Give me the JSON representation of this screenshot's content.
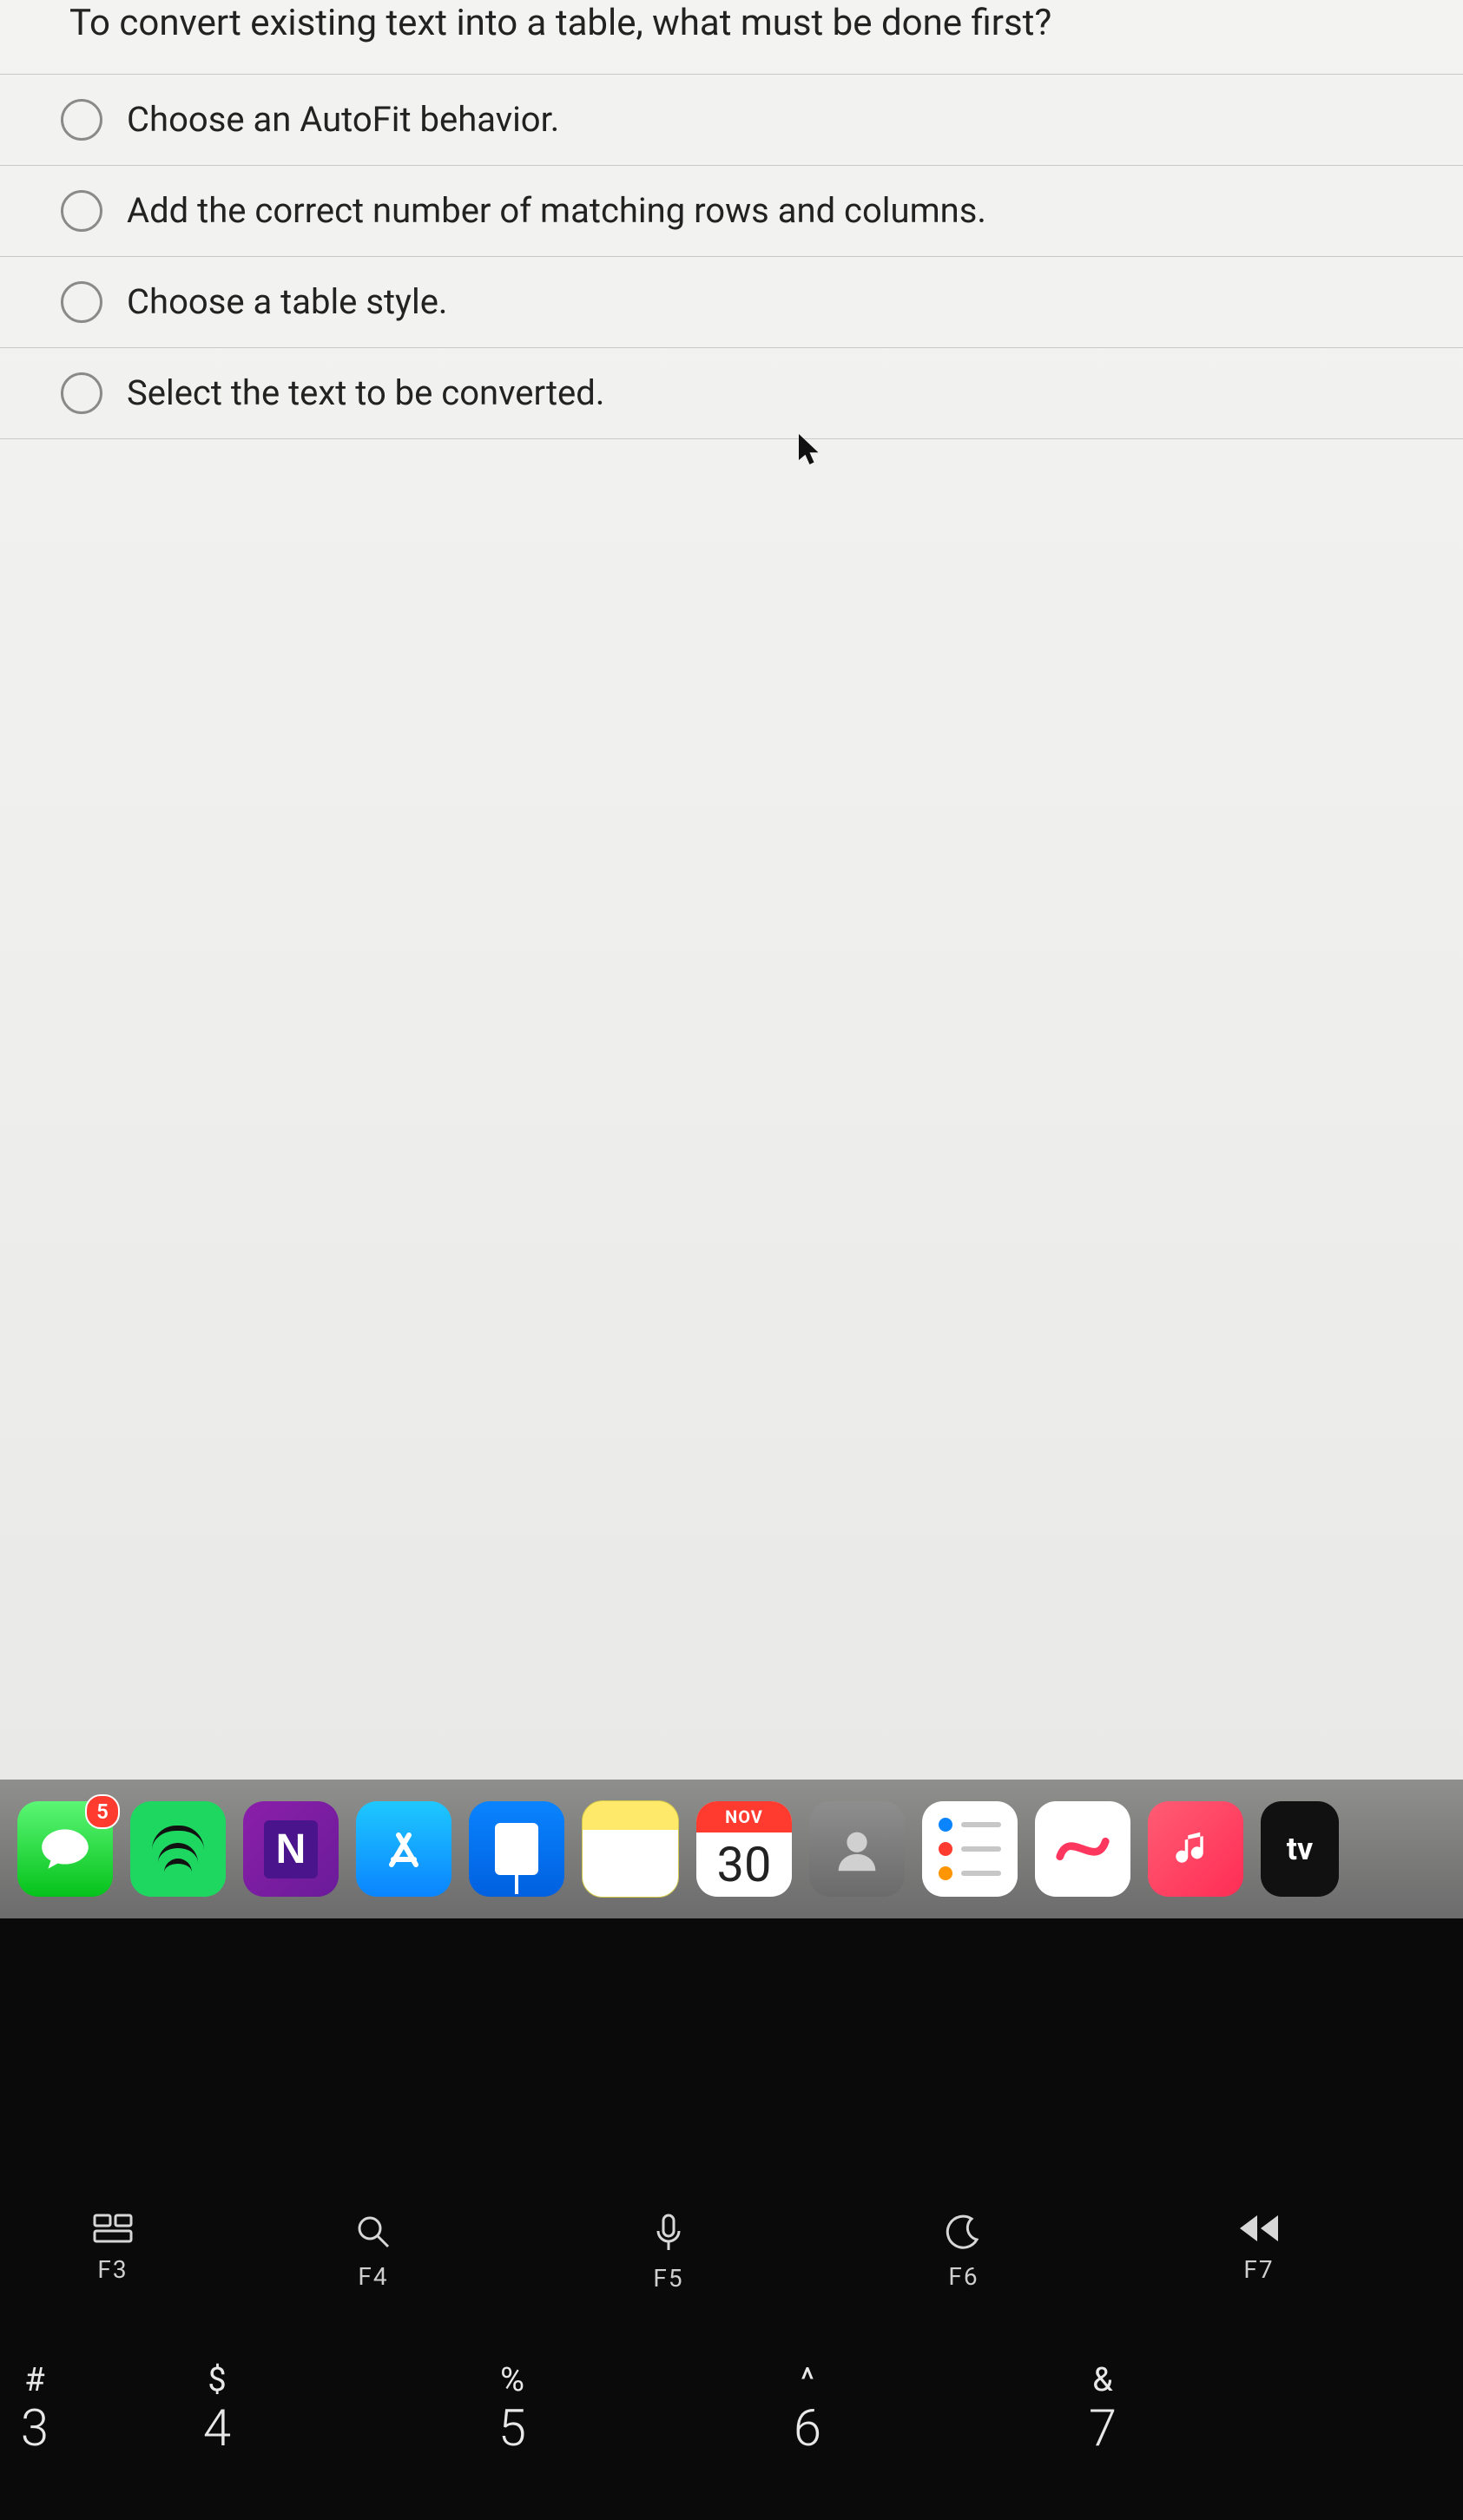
{
  "quiz": {
    "question": "To convert existing text into a table, what must be done first?",
    "options": [
      "Choose an AutoFit behavior.",
      "Add the correct number of matching rows and columns.",
      "Choose a table style.",
      "Select the text to be converted."
    ]
  },
  "dock": {
    "calendar": {
      "month": "NOV",
      "day": "30"
    },
    "messages_badge": "5",
    "tv_label": "tv"
  },
  "keyboard": {
    "fn": [
      {
        "glyph": "⌗",
        "label": "F3"
      },
      {
        "glyph": "🔍",
        "label": "F4"
      },
      {
        "glyph": "🎙",
        "label": "F5"
      },
      {
        "glyph": "☾",
        "label": "F6"
      },
      {
        "glyph": "◂◂",
        "label": "F7"
      }
    ],
    "num": [
      {
        "sym": "#",
        "num": "3"
      },
      {
        "sym": "$",
        "num": "4"
      },
      {
        "sym": "%",
        "num": "5"
      },
      {
        "sym": "^",
        "num": "6"
      },
      {
        "sym": "&",
        "num": "7"
      }
    ]
  }
}
